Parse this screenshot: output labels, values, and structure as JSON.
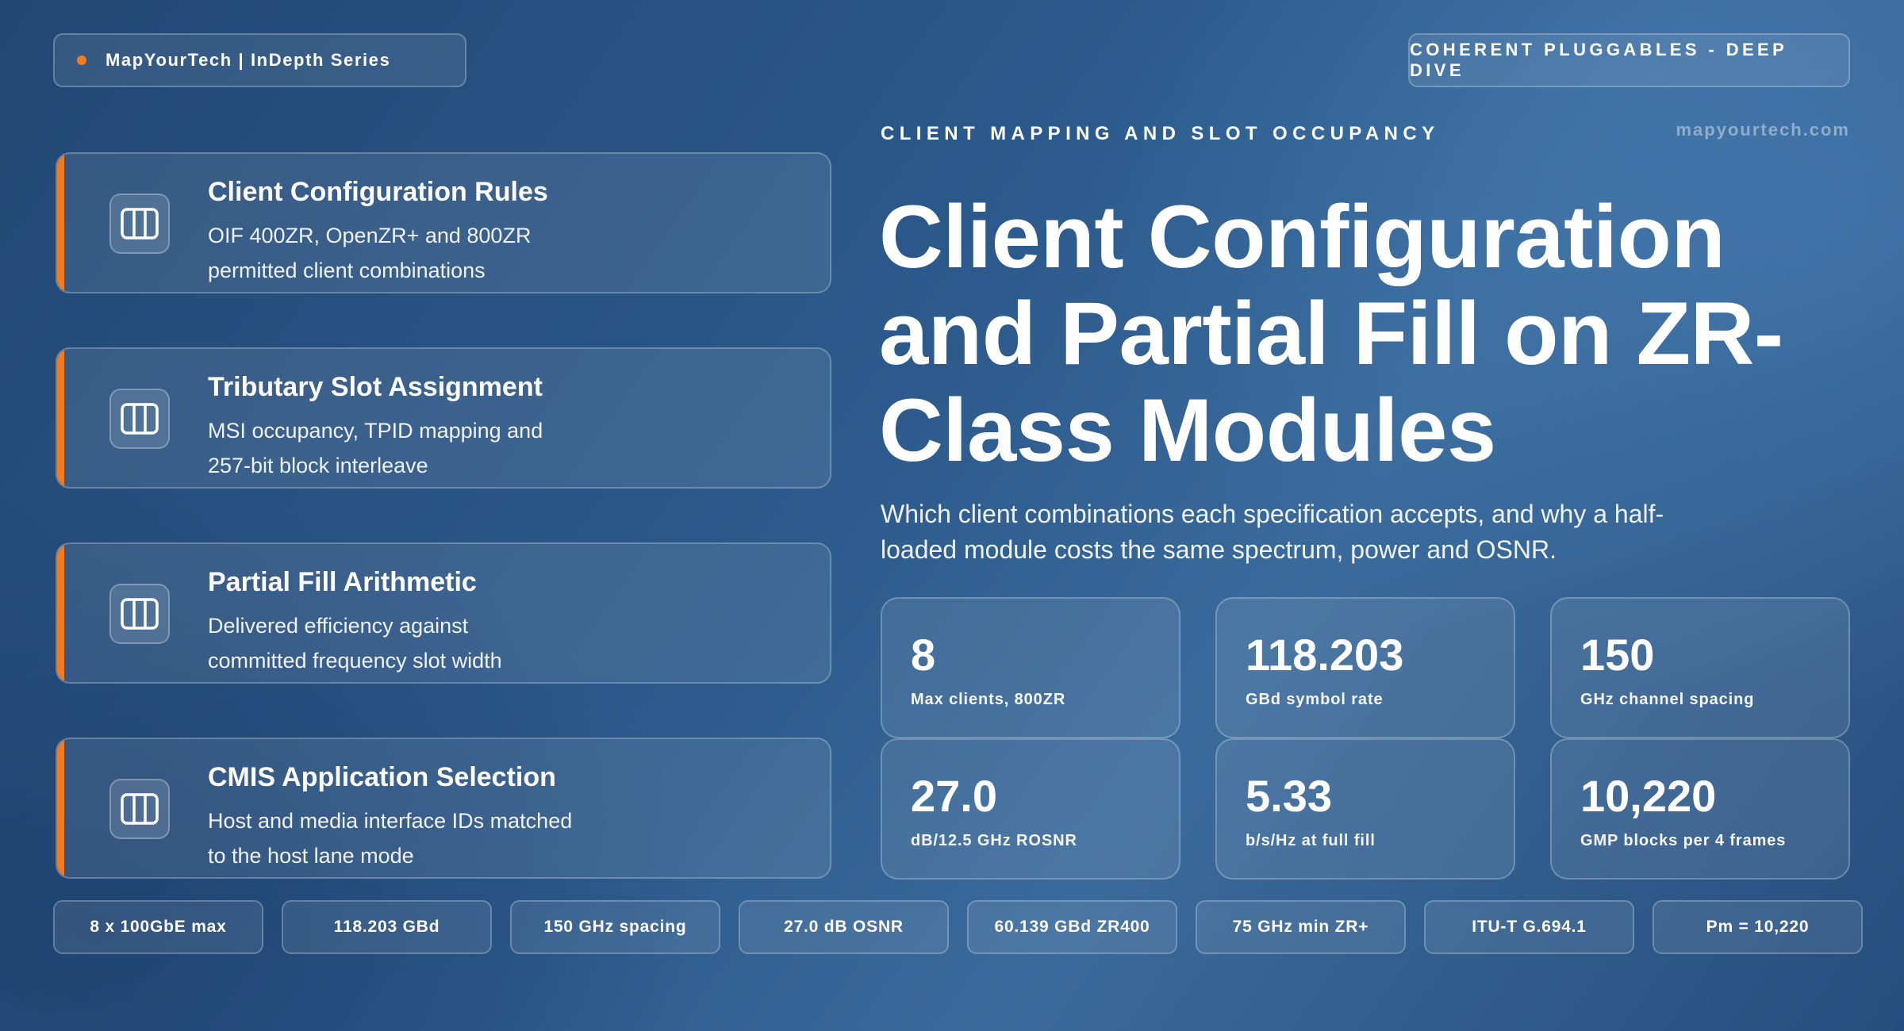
{
  "header": {
    "brand": "MapYourTech | InDepth Series",
    "series_tag": "COHERENT PLUGGABLES - DEEP DIVE",
    "eyebrow": "CLIENT MAPPING AND SLOT OCCUPANCY",
    "website": "mapyourtech.com"
  },
  "hero": {
    "title": "Client Configuration and Partial Fill on ZR-Class Modules",
    "subtitle": "Which client combinations each specification accepts, and why a half-loaded module costs the same spectrum, power and OSNR."
  },
  "topics": [
    {
      "title": "Client Configuration Rules",
      "desc": "OIF 400ZR, OpenZR+ and 800ZR permitted client combinations",
      "icon": "columns-icon"
    },
    {
      "title": "Tributary Slot Assignment",
      "desc": "MSI occupancy, TPID mapping and 257-bit block interleave",
      "icon": "columns-icon"
    },
    {
      "title": "Partial Fill Arithmetic",
      "desc": "Delivered efficiency against committed frequency slot width",
      "icon": "columns-icon"
    },
    {
      "title": "CMIS Application Selection",
      "desc": "Host and media interface IDs matched to the host lane mode",
      "icon": "columns-icon"
    }
  ],
  "stats": [
    {
      "value": "8",
      "label": "Max clients, 800ZR"
    },
    {
      "value": "118.203",
      "label": "GBd symbol rate"
    },
    {
      "value": "150",
      "label": "GHz channel spacing"
    },
    {
      "value": "27.0",
      "label": "dB/12.5 GHz ROSNR"
    },
    {
      "value": "5.33",
      "label": "b/s/Hz at full fill"
    },
    {
      "value": "10,220",
      "label": "GMP blocks per 4 frames"
    }
  ],
  "chips": [
    "8 x 100GbE max",
    "118.203 GBd",
    "150 GHz spacing",
    "27.0 dB OSNR",
    "60.139 GBd ZR400",
    "75 GHz min ZR+",
    "ITU-T G.694.1",
    "Pm = 10,220"
  ],
  "colors": {
    "accent": "#f47a20",
    "background_dark": "#214774",
    "background_light": "#3a6a9b"
  }
}
